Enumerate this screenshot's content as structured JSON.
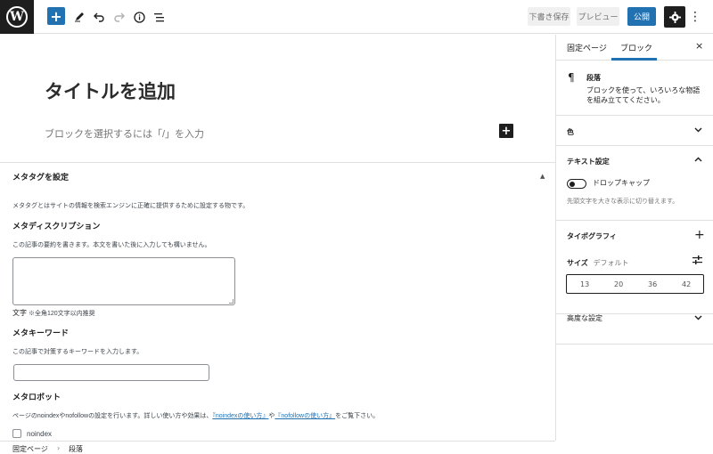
{
  "toolbar": {
    "logo": "W",
    "draft_label": "下書き保存",
    "preview_label": "プレビュー",
    "publish_label": "公開"
  },
  "editor": {
    "title": "タイトルを追加",
    "placeholder": "ブロックを選択するには「/」を入力"
  },
  "metabox": {
    "heading": "メタタグを設定",
    "intro": "メタタグとはサイトの情報を検索エンジンに正確に提供するために設定する物です。",
    "description": {
      "heading": "メタディスクリプション",
      "help": "この記事の要約を書きます。本文を書いた後に入力しても構いません。",
      "char_note_label": "文字",
      "char_note": "※全角120文字以内推奨"
    },
    "keywords": {
      "heading": "メタキーワード",
      "help": "この記事で対策するキーワードを入力します。"
    },
    "robots": {
      "heading": "メタロボット",
      "help_prefix": "ページのnoindexやnofollowの設定を行います。詳しい使い方や効果は、",
      "link1": "『noindexの使い方』",
      "between": "や",
      "link2": "『nofollowの使い方』",
      "help_suffix": "をご覧下さい。",
      "noindex_label": "noindex"
    }
  },
  "sidebar": {
    "tabs": [
      "固定ページ",
      "ブロック"
    ],
    "active_tab": "ブロック",
    "close": "×",
    "block": {
      "name": "段落",
      "description": "ブロックを使って、いろいろな物語を組み立ててください。"
    },
    "panels": {
      "color": "色",
      "text_settings": "テキスト設定",
      "drop_cap_label": "ドロップキャップ",
      "drop_cap_enabled": false,
      "drop_cap_help": "先頭文字を大きな表示に切り替えます。",
      "typography": "タイポグラフィ",
      "size_label": "サイズ",
      "size_value": "デフォルト",
      "size_options": [
        "13",
        "20",
        "36",
        "42"
      ],
      "advanced": "高度な設定"
    }
  },
  "breadcrumb": [
    "固定ページ",
    "段落"
  ],
  "breadcrumb_separator": "›",
  "colors": {
    "accent": "#2271b1",
    "dark": "#1e1e1e",
    "border": "#e0e0e0"
  }
}
